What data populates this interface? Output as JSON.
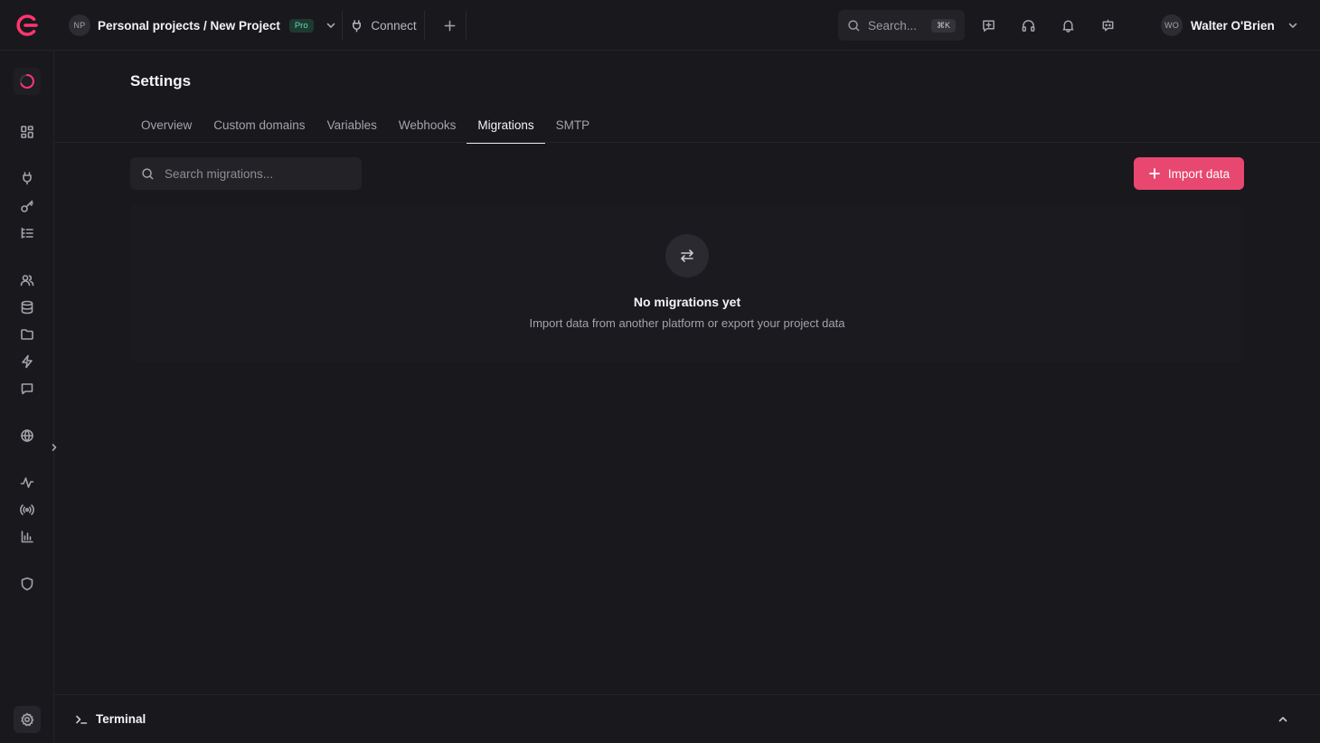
{
  "header": {
    "project_initials": "NP",
    "project_name": "Personal projects / New Project",
    "plan_badge": "Pro",
    "connect_label": "Connect",
    "search_placeholder": "Search...",
    "search_shortcut": "⌘K",
    "user_initials": "WO",
    "user_name": "Walter O'Brien"
  },
  "sidebar": {
    "items": [
      {
        "name": "loading-spinner",
        "icon": "spinner-icon"
      },
      {
        "name": "overview",
        "icon": "grid-icon"
      },
      {
        "name": "integrations",
        "icon": "plug-icon"
      },
      {
        "name": "auth-keys",
        "icon": "key-icon"
      },
      {
        "name": "logs",
        "icon": "list-icon"
      },
      {
        "name": "users",
        "icon": "users-icon"
      },
      {
        "name": "databases",
        "icon": "database-icon"
      },
      {
        "name": "storage",
        "icon": "folder-icon"
      },
      {
        "name": "functions",
        "icon": "bolt-icon"
      },
      {
        "name": "messaging",
        "icon": "message-icon"
      },
      {
        "name": "sites",
        "icon": "globe-icon"
      },
      {
        "name": "activity",
        "icon": "activity-icon"
      },
      {
        "name": "realtime",
        "icon": "broadcast-icon"
      },
      {
        "name": "usage",
        "icon": "bar-chart-icon"
      },
      {
        "name": "security",
        "icon": "shield-icon"
      },
      {
        "name": "settings",
        "icon": "gear-icon"
      }
    ]
  },
  "page": {
    "title": "Settings",
    "tabs": [
      {
        "label": "Overview",
        "active": false
      },
      {
        "label": "Custom domains",
        "active": false
      },
      {
        "label": "Variables",
        "active": false
      },
      {
        "label": "Webhooks",
        "active": false
      },
      {
        "label": "Migrations",
        "active": true
      },
      {
        "label": "SMTP",
        "active": false
      }
    ],
    "search_placeholder": "Search migrations...",
    "import_label": "Import data",
    "empty_title": "No migrations yet",
    "empty_subtitle": "Import data from another platform or export your project data"
  },
  "terminal": {
    "label": "Terminal"
  },
  "colors": {
    "accent": "#fd366e",
    "button": "#e8476f",
    "background": "#19181d"
  }
}
